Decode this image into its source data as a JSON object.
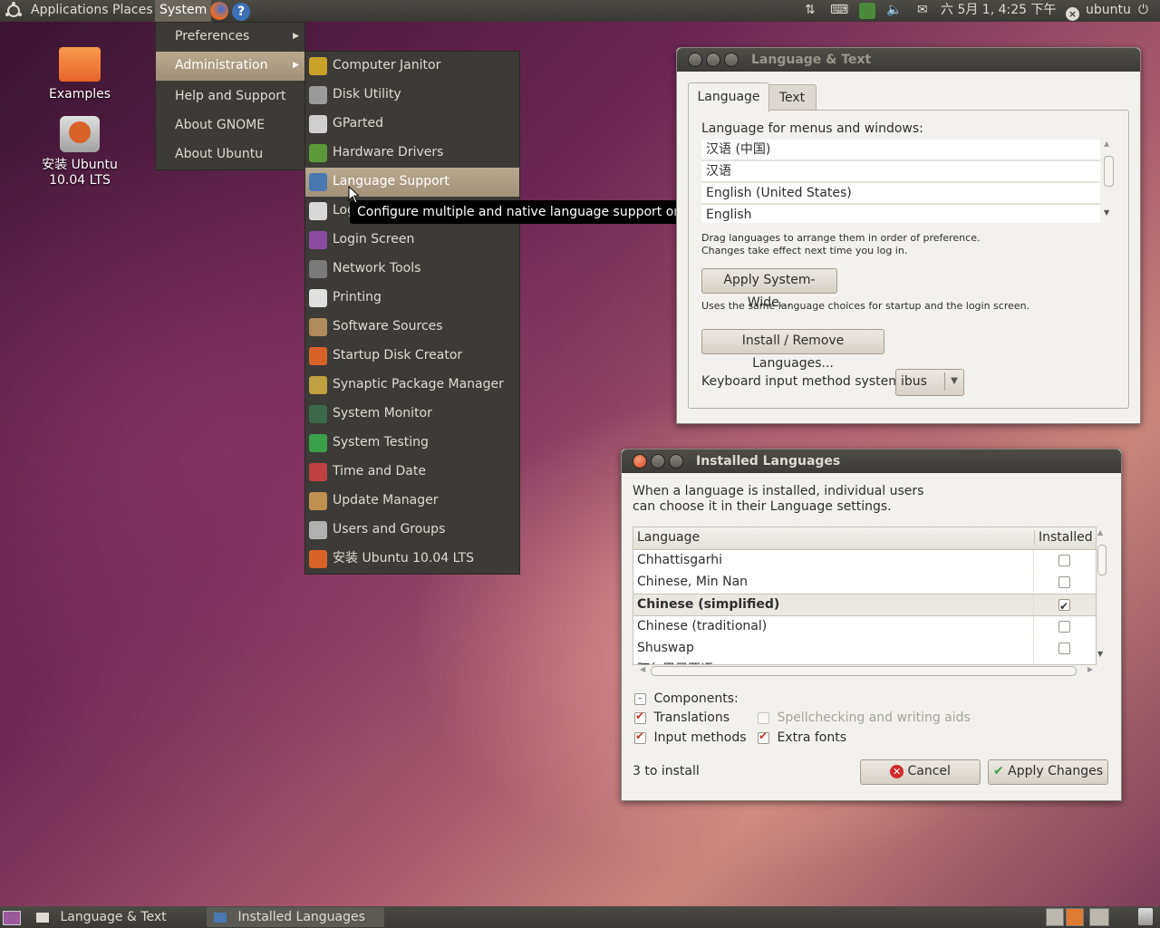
{
  "top_panel": {
    "menus": [
      "Applications",
      "Places",
      "System"
    ],
    "clock": "六 5月  1, 4:25 下午",
    "user": "ubuntu"
  },
  "desktop": {
    "icons": [
      "Examples",
      "安装 Ubuntu 10.04 LTS"
    ]
  },
  "system_menu": {
    "items": [
      "Preferences",
      "Administration",
      "Help and Support",
      "About GNOME",
      "About Ubuntu"
    ]
  },
  "admin_menu": {
    "items": [
      {
        "label": "Computer Janitor",
        "icon": "broom-icon",
        "color": "#c9a227"
      },
      {
        "label": "Disk Utility",
        "icon": "disk-icon",
        "color": "#9a9a9a"
      },
      {
        "label": "GParted",
        "icon": "gparted-icon",
        "color": "#cfcfcf"
      },
      {
        "label": "Hardware Drivers",
        "icon": "chip-icon",
        "color": "#5a9a3a"
      },
      {
        "label": "Language Support",
        "icon": "flag-icon",
        "color": "#4a78b0"
      },
      {
        "label": "Log File Viewer",
        "icon": "magnifier-icon",
        "color": "#d8d8d8"
      },
      {
        "label": "Login Screen",
        "icon": "login-icon",
        "color": "#8a4aa0"
      },
      {
        "label": "Network Tools",
        "icon": "network-icon",
        "color": "#7a7a7a"
      },
      {
        "label": "Printing",
        "icon": "printer-icon",
        "color": "#e0e0e0"
      },
      {
        "label": "Software Sources",
        "icon": "box-icon",
        "color": "#b08a5a"
      },
      {
        "label": "Startup Disk Creator",
        "icon": "ubuntu-icon",
        "color": "#d9622b"
      },
      {
        "label": "Synaptic Package Manager",
        "icon": "package-icon",
        "color": "#c0a040"
      },
      {
        "label": "System Monitor",
        "icon": "monitor-icon",
        "color": "#3a6a4a"
      },
      {
        "label": "System Testing",
        "icon": "check-icon",
        "color": "#3aa04a"
      },
      {
        "label": "Time and Date",
        "icon": "calendar-icon",
        "color": "#c04040"
      },
      {
        "label": "Update Manager",
        "icon": "update-icon",
        "color": "#c09050"
      },
      {
        "label": "Users and Groups",
        "icon": "users-icon",
        "color": "#b0b0b0"
      },
      {
        "label": "安装 Ubuntu 10.04 LTS",
        "icon": "installer-icon",
        "color": "#d9622b"
      }
    ],
    "tooltip": "Configure multiple and native language support on your system"
  },
  "language_text": {
    "title": "Language & Text",
    "tabs": [
      "Language",
      "Text"
    ],
    "menus_label": "Language for menus and windows:",
    "languages": [
      "汉语 (中国)",
      "汉语",
      "English (United States)",
      "English"
    ],
    "drag_hint_1": "Drag languages to arrange them in order of preference.",
    "drag_hint_2": "Changes take effect next time you log in.",
    "apply_system_wide": "Apply System-Wide...",
    "system_wide_hint": "Uses the same language choices for startup and the login screen.",
    "install_remove": "Install / Remove Languages...",
    "keyboard_label": "Keyboard input method system:",
    "keyboard_value": "ibus"
  },
  "installed_languages": {
    "title": "Installed Languages",
    "intro_1": "When a language is installed, individual users",
    "intro_2": "can choose it in their Language settings.",
    "col_language": "Language",
    "col_installed": "Installed",
    "rows": [
      {
        "name": "Chhattisgarhi",
        "installed": false
      },
      {
        "name": "Chinese, Min Nan",
        "installed": false
      },
      {
        "name": "Chinese (simplified)",
        "installed": true
      },
      {
        "name": "Chinese (traditional)",
        "installed": false
      },
      {
        "name": "Shuswap",
        "installed": false
      },
      {
        "name": "阿尔巴尼亚语",
        "installed": false
      }
    ],
    "components_label": "Components:",
    "translations": "Translations",
    "input_methods": "Input methods",
    "spellchecking": "Spellchecking and writing aids",
    "extra_fonts": "Extra fonts",
    "status": "3 to install",
    "cancel": "Cancel",
    "apply": "Apply Changes"
  },
  "taskbar": {
    "tasks": [
      "Language & Text",
      "Installed Languages"
    ]
  }
}
